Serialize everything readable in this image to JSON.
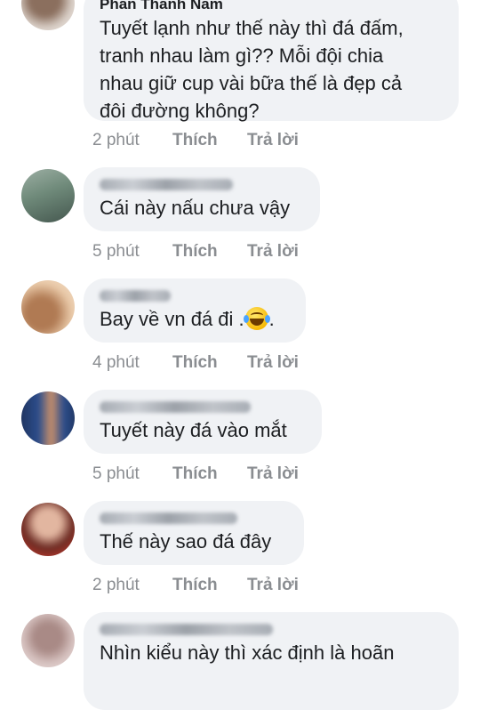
{
  "comments": [
    {
      "name": "Phan Thanh Nam",
      "text": "Tuyết lạnh như thế này thì đá đấm,\ntranh nhau làm gì?? Mỗi đội chia\nnhau giữ cup vài bữa thế là đẹp cả\nđôi đường không?",
      "time": "2 phút",
      "like": "Thích",
      "reply": "Trả lời",
      "avatar_colors": [
        "#d9cfc7",
        "#8b6f5e",
        "#efe9e4"
      ]
    },
    {
      "name": "",
      "text": "Cái này nấu chưa vậy",
      "time": "5 phút",
      "like": "Thích",
      "reply": "Trả lời",
      "avatar_colors": [
        "#6f8a7a",
        "#3d4e47",
        "#a7b7ad"
      ]
    },
    {
      "name": "",
      "text": "Bay về vn đá đi .",
      "emoji": "tears-of-joy-emoji",
      "text_after": ".",
      "time": "4 phút",
      "like": "Thích",
      "reply": "Trả lời",
      "avatar_colors": [
        "#e9c9a8",
        "#b07a53",
        "#f6e6d5"
      ]
    },
    {
      "name": "",
      "text": "Tuyết này đá vào mắt",
      "time": "5 phút",
      "like": "Thích",
      "reply": "Trả lời",
      "avatar_colors": [
        "#2b4d8c",
        "#c88f6a",
        "#1e2f55"
      ]
    },
    {
      "name": "",
      "text": "Thế này sao đá đây",
      "time": "2 phút",
      "like": "Thích",
      "reply": "Trả lời",
      "avatar_colors": [
        "#c23a2f",
        "#e2b6a0",
        "#6b2a22"
      ]
    },
    {
      "name": "",
      "text": "Nhìn kiểu này thì xác định là hoãn",
      "time": "",
      "like": "",
      "reply": "",
      "avatar_colors": [
        "#d8c4c2",
        "#a98a86",
        "#efe3e1"
      ]
    }
  ]
}
